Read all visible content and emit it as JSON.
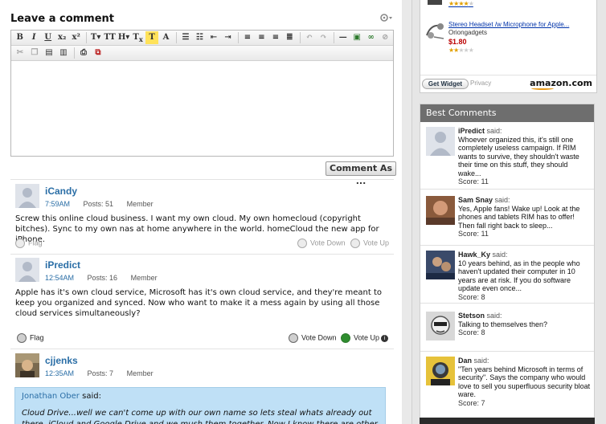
{
  "leave_comment": {
    "title": "Leave a comment",
    "settings_icon": "gear-icon"
  },
  "toolbar": {
    "row1": [
      "B",
      "I",
      "U",
      "x₂",
      "x²",
      "T",
      "T",
      "H",
      "T",
      "T",
      "list",
      "list",
      "outdent",
      "indent",
      "left",
      "center",
      "right",
      "justify",
      "undo",
      "redo",
      "hr",
      "image",
      "link",
      "unlink"
    ],
    "row2": [
      "cut",
      "copy",
      "paste",
      "paste-word",
      "print",
      "source"
    ]
  },
  "comment_as_label": "Comment As ...",
  "comments": [
    {
      "author": "iCandy",
      "time": "7:59AM",
      "posts": "Posts: 51",
      "role": "Member",
      "body": "Screw this online cloud business. I want my own cloud. My own homecloud (copyright bitches). Sync to my own nas at home anywhere in the world. homeCloud the new app for iPhone.",
      "flag": "Flag",
      "vote_down": "Vote Down",
      "vote_up": "Vote Up"
    },
    {
      "author": "iPredict",
      "time": "12:54AM",
      "posts": "Posts: 16",
      "role": "Member",
      "body": "Apple has it's own cloud service, Microsoft has it's own cloud service, and they're meant to keep you organized and synced. Now who want to make it a mess again by using all those cloud services simultaneously?",
      "flag": "Flag",
      "vote_down": "Vote Down",
      "vote_up": "Vote Up"
    },
    {
      "author": "cjjenks",
      "time": "12:35AM",
      "posts": "Posts: 7",
      "role": "Member",
      "quote_author": "Jonathan Ober",
      "quote_said": "said:",
      "quote_text": "Cloud Drive...well we can't come up with our own name so lets steal whats already out there. iCloud and Google Drive and we mush them together. Now I know there are other Clouds out"
    }
  ],
  "amazon": {
    "products": [
      {
        "name": "",
        "seller": "",
        "price": "",
        "stars": 4
      },
      {
        "name": "Stereo Headset /w Microphone for Apple...",
        "seller": "Oriongadgets",
        "price": "$1.80",
        "stars": 2
      }
    ],
    "get_widget": "Get Widget",
    "privacy": "Privacy",
    "logo": "amazon.com"
  },
  "best_comments": {
    "title": "Best Comments",
    "items": [
      {
        "name": "iPredict",
        "said": "said:",
        "text": "Whoever organized this, it's still one completely useless campaign. If RIM wants to survive, they shouldn't waste their time on this stuff, they should wake...",
        "score": "Score: 11"
      },
      {
        "name": "Sam Snay",
        "said": "said:",
        "text": "Yes, Apple fans! Wake up! Look at the phones and tablets RIM has to offer! Then fall right back to sleep...",
        "score": "Score: 11"
      },
      {
        "name": "Hawk_Ky",
        "said": "said:",
        "text": "10 years behind, as in the people who haven't updated their computer in 10 years are at risk.  If you do software update even once...",
        "score": "Score: 8"
      },
      {
        "name": "Stetson",
        "said": "said:",
        "text": "Talking to themselves then?",
        "score": "Score: 8"
      },
      {
        "name": "Dan",
        "said": "said:",
        "text": "\"Ten years behind Microsoft in terms of security\". Says the company who would love to sell you superfluous security bloat ware.",
        "score": "Score: 7"
      }
    ]
  },
  "colors": {
    "link": "#2a6ea6",
    "quote_bg": "#bfe0f6",
    "header_bg": "#6e6e6e",
    "price": "#b00000"
  }
}
